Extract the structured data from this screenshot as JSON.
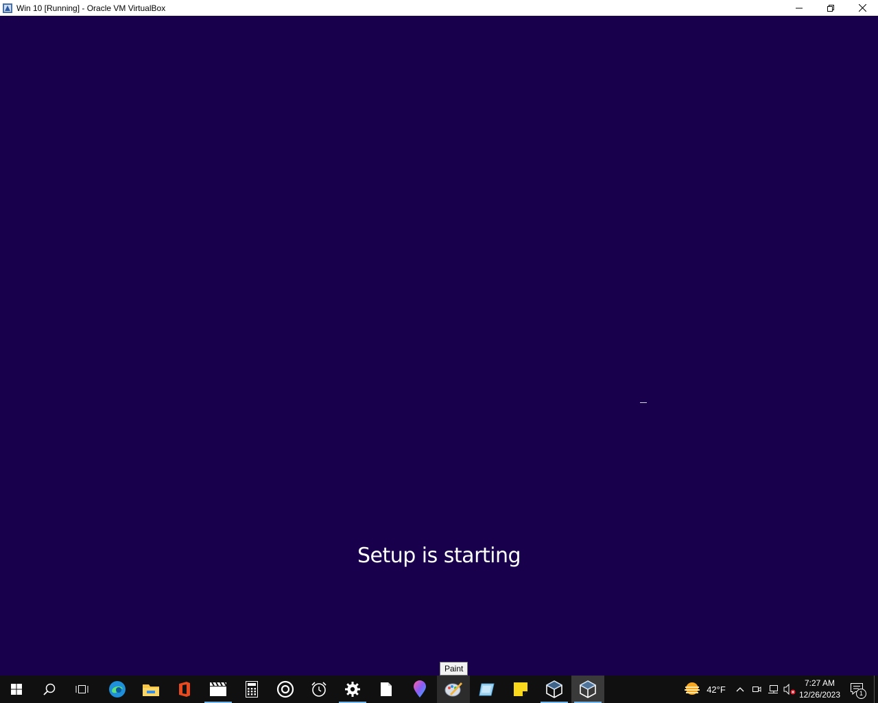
{
  "window": {
    "title": "Win 10 [Running] - Oracle VM VirtualBox",
    "controls": [
      "minimize",
      "restore",
      "close"
    ]
  },
  "vm": {
    "status_text": "Setup is starting",
    "background_color": "#18004d"
  },
  "tooltip": {
    "text": "Paint"
  },
  "taskbar": {
    "apps": [
      {
        "name": "start",
        "icon": "windows-logo-icon"
      },
      {
        "name": "search",
        "icon": "search-icon"
      },
      {
        "name": "task-view",
        "icon": "task-view-icon"
      },
      {
        "name": "edge",
        "icon": "edge-icon"
      },
      {
        "name": "file-explorer",
        "icon": "folder-icon"
      },
      {
        "name": "office",
        "icon": "office-icon"
      },
      {
        "name": "video-editor",
        "icon": "clapperboard-icon"
      },
      {
        "name": "calculator",
        "icon": "calculator-icon"
      },
      {
        "name": "groove",
        "icon": "target-icon"
      },
      {
        "name": "alarms",
        "icon": "alarm-clock-icon"
      },
      {
        "name": "settings",
        "icon": "gear-icon"
      },
      {
        "name": "notepad",
        "icon": "document-icon"
      },
      {
        "name": "maps",
        "icon": "map-pin-icon"
      },
      {
        "name": "paint",
        "icon": "paint-palette-icon"
      },
      {
        "name": "snipping-tool",
        "icon": "snip-icon"
      },
      {
        "name": "sticky-notes",
        "icon": "sticky-note-icon"
      },
      {
        "name": "virtualbox",
        "icon": "cube-icon"
      },
      {
        "name": "virtualbox-vm",
        "icon": "cube-icon"
      }
    ],
    "weather": {
      "temperature": "42°F",
      "icon": "sun-haze-icon"
    },
    "tray_icons": [
      "chevron-up-icon",
      "meet-now-icon",
      "network-icon",
      "volume-muted-icon"
    ],
    "clock": {
      "time": "7:27 AM",
      "date": "12/26/2023"
    },
    "notifications": {
      "count": "1",
      "icon": "notification-icon"
    },
    "accent_color": "#76b9ed"
  }
}
